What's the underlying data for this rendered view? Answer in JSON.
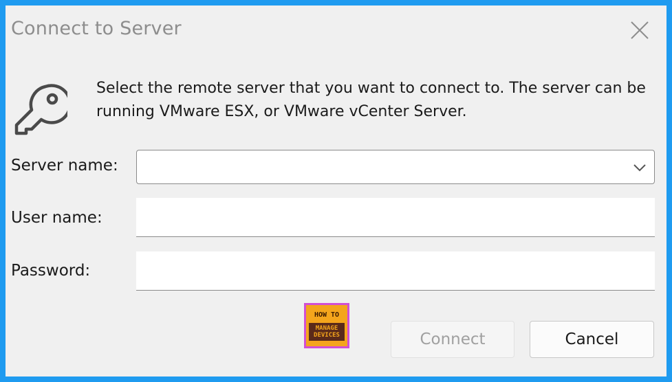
{
  "dialog": {
    "title": "Connect to Server",
    "description": "Select the remote server that you want to connect to. The server can be running VMware ESX, or VMware vCenter Server.",
    "fields": {
      "server_label": "Server name:",
      "server_value": "",
      "user_label": "User name:",
      "user_value": "",
      "password_label": "Password:",
      "password_value": ""
    },
    "buttons": {
      "connect": "Connect",
      "cancel": "Cancel"
    }
  },
  "watermark": {
    "line1": "HOW TO",
    "line2": "MANAGE",
    "line3": "DEVICES"
  },
  "icons": [
    "close-icon",
    "key-icon",
    "chevron-down-icon"
  ],
  "colors": {
    "frame": "#1f9bf0",
    "dialog_bg": "#f0f0f0",
    "disabled_text": "#a0a0a0"
  }
}
